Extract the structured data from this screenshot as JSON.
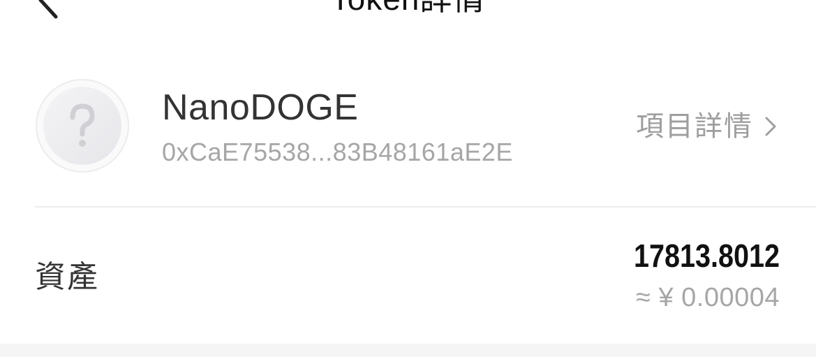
{
  "header": {
    "title": "Token詳情",
    "back_icon": "chevron-left-icon"
  },
  "token": {
    "name": "NanoDOGE",
    "address": "0xCaE75538...83B48161aE2E",
    "logo_icon": "question-mark-icon",
    "project_detail_label": "項目詳情",
    "project_detail_icon": "chevron-right-icon"
  },
  "asset": {
    "label": "資產",
    "amount": "17813.8012",
    "fiat_value": "≈ ¥ 0.00004"
  },
  "colors": {
    "background": "#ffffff",
    "primary_text": "#111111",
    "secondary_text": "#a6a6a6",
    "divider": "#ececec",
    "footer_band": "#f5f5f5"
  }
}
